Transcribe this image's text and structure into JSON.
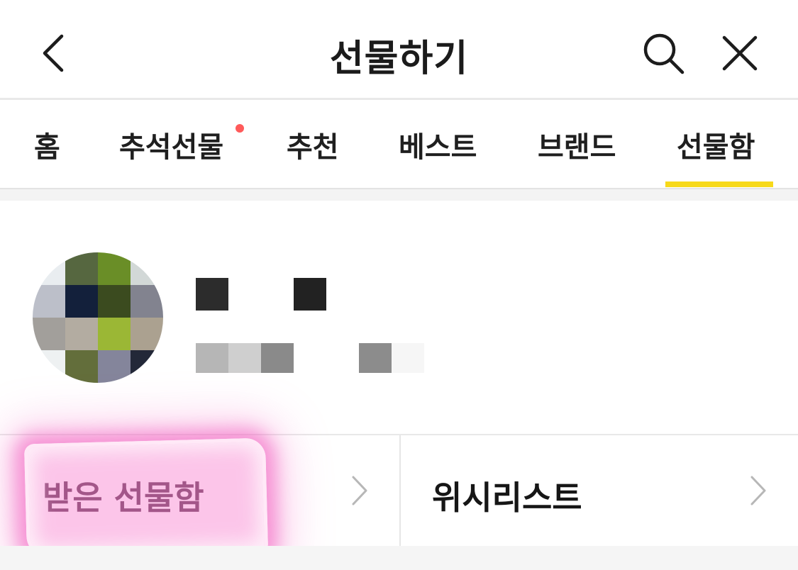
{
  "header": {
    "title": "선물하기",
    "back_icon": "chevron-left-icon",
    "search_icon": "search-icon",
    "close_icon": "close-icon"
  },
  "tabs": [
    {
      "label": "홈",
      "active": false
    },
    {
      "label": "추석선물",
      "active": false,
      "has_new_dot": true
    },
    {
      "label": "추천",
      "active": false
    },
    {
      "label": "베스트",
      "active": false
    },
    {
      "label": "브랜드",
      "active": false
    },
    {
      "label": "선물함",
      "active": true
    }
  ],
  "colors": {
    "active_indicator": "#f7d91a",
    "new_dot": "#ff5a5a",
    "highlight": "#f59bd6"
  },
  "menu": {
    "received_label": "받은 선물함",
    "wishlist_label": "위시리스트"
  }
}
